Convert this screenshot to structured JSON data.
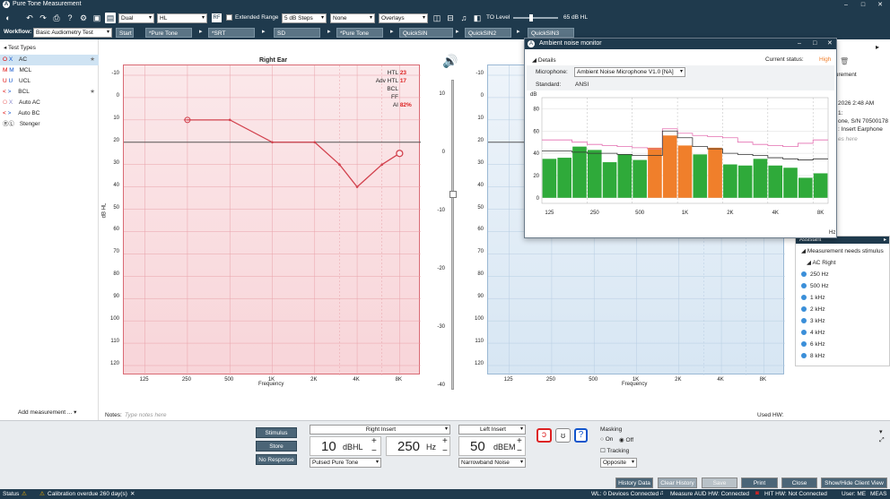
{
  "window": {
    "title": "Pure Tone Measurement"
  },
  "toolbar": {
    "mode": "Dual",
    "scale": "HL",
    "extended_range_label": "Extended Range",
    "step": "5 dB Steps",
    "none_select": "None",
    "overlays": "Overlays",
    "to_level_label": "TO Level",
    "to_level_value": "65 dB HL",
    "to_level_fraction": 0.35
  },
  "workflow": {
    "label": "Workflow:",
    "value": "Basic Audiometry Test",
    "start": "Start",
    "steps": [
      "*Pure Tone (AC)",
      "*SRT",
      "SD",
      "*Pure Tone (BC)",
      "QuickSIN",
      "QuickSIN2",
      "QuickSIN3"
    ]
  },
  "sidebar": {
    "header": "Test Types",
    "items": [
      {
        "sym": "O X",
        "label": "AC"
      },
      {
        "sym": "M M",
        "label": "MCL"
      },
      {
        "sym": "U U",
        "label": "UCL"
      },
      {
        "sym": "< >",
        "label": "BCL"
      },
      {
        "sym": "O X",
        "label": "Auto AC"
      },
      {
        "sym": "< >",
        "label": "Auto BC"
      },
      {
        "sym": "RL",
        "label": "Stenger"
      }
    ],
    "add_measurement": "Add measurement ..."
  },
  "audiogram": {
    "left_title": "Right Ear",
    "stats": [
      {
        "k": "HTL",
        "v": "23"
      },
      {
        "k": "Adv HTL",
        "v": "17"
      },
      {
        "k": "BCL",
        "v": ""
      },
      {
        "k": "FF",
        "v": ""
      },
      {
        "k": "AI",
        "v": "82%"
      }
    ],
    "ylabel": "dB HL",
    "xlabel": "Frequency",
    "yticks": [
      "-10",
      "0",
      "10",
      "20",
      "30",
      "40",
      "50",
      "60",
      "70",
      "80",
      "90",
      "100",
      "110",
      "120"
    ],
    "xticks": [
      "125",
      "250",
      "500",
      "1K",
      "2K",
      "4K",
      "8K"
    ],
    "level_ticks": [
      "10",
      "0",
      "-10",
      "-20",
      "-30",
      "-40"
    ]
  },
  "chart_data": {
    "type": "line",
    "title": "Right Ear",
    "xlabel": "Frequency",
    "ylabel": "dB HL",
    "x": [
      "250",
      "500",
      "1K",
      "2K",
      "3K",
      "4K",
      "6K",
      "8K"
    ],
    "series": [
      {
        "values": [
          10,
          10,
          20,
          20,
          30,
          40,
          30,
          25
        ]
      }
    ],
    "ylim": [
      -10,
      120
    ],
    "reference_line": 20
  },
  "noise_monitor": {
    "title": "Ambient noise monitor",
    "details": "Details",
    "current_status_label": "Current status:",
    "current_status": "High",
    "microphone_label": "Microphone:",
    "microphone": "Ambient Noise Microphone V1.0 [NA]",
    "standard_label": "Standard:",
    "standard": "ANSI",
    "ylabel": "dB",
    "xunit": "Hz",
    "yticks": [
      "80",
      "60",
      "40",
      "20",
      "0"
    ],
    "xticks": [
      "125",
      "250",
      "500",
      "1K",
      "2K",
      "4K",
      "8K"
    ],
    "bars": [
      35,
      36,
      46,
      43,
      32,
      39,
      34,
      45,
      56,
      47,
      39,
      45,
      30,
      29,
      35,
      29,
      27,
      18,
      22
    ],
    "colors": {
      "ok": "#2faa3a",
      "high": "#f07f2b"
    },
    "high_index": [
      7,
      8,
      9,
      11
    ]
  },
  "right_panel": {
    "partial_header": "asurement",
    "date": "2026 2:48 AM",
    "line1": "1:",
    "line2": "one, S/N 70500178",
    "line3": ": Insert Earphone",
    "notes_hint": "es here",
    "assistant": "Assistant",
    "needs": "Measurement needs stimulus",
    "ac": "AC Right",
    "freqs": [
      "250 Hz",
      "500 Hz",
      "1 kHz",
      "2 kHz",
      "3 kHz",
      "4 kHz",
      "6 kHz",
      "8 kHz"
    ]
  },
  "notes": {
    "label": "Notes:",
    "placeholder": "Type notes here",
    "used_hw": "Used HW:"
  },
  "controls": {
    "stimulus": "Stimulus",
    "store": "Store",
    "no_response": "No Response",
    "right_transducer": "Right Insert",
    "left_transducer": "Left Insert",
    "right_level": "10",
    "right_unit": "dBHL",
    "frequency": "250",
    "freq_unit": "Hz",
    "left_level": "50",
    "left_unit": "dBEM",
    "right_signal": "Pulsed Pure Tone",
    "left_signal": "Narrowband Noise",
    "masking_label": "Masking",
    "on": "On",
    "off": "Off",
    "tracking": "Tracking",
    "opposite": "Opposite"
  },
  "actions": [
    "History Data",
    "Clear History",
    "Save",
    "Print",
    "Close",
    "Show/Hide Client View"
  ],
  "status": {
    "label": "Status",
    "calibration": "Calibration overdue 260 day(s)",
    "wl": "WL: 0 Devices Connected",
    "measure": "Measure AUD HW: Connected",
    "hit": "HIT HW: Not Connected",
    "user": "User: ME",
    "meas": "MEAS"
  }
}
